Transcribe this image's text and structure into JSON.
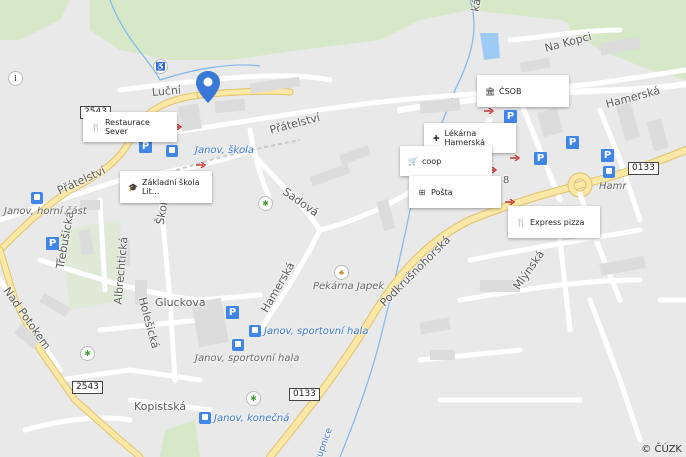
{
  "streets": {
    "na_kopci": "Na Kopci",
    "hamerska_ne": "Hamerská",
    "lucni": "Luční",
    "pratelstvi_1": "Přátelství",
    "pratelstvi_2": "Přátelství",
    "sadova": "Sadová",
    "podkrusnohorska": "Podkrušnohorská",
    "mlynska": "Mlýnská",
    "skolska": "Školská",
    "trebusicka": "Třebušická",
    "albrechticka": "Albrechtická",
    "holesicka": "Holešická",
    "gluckova": "Gluckova",
    "hamerska_mid": "Hamerská",
    "nad_potokem": "Nad Potokem",
    "kopistska": "Kopistská",
    "dupnice": "Dupnice",
    "kostelni_partial": "ká",
    "partial_8": "8"
  },
  "stops": {
    "janov_skola": "Janov, škola",
    "janov_horni_cast": "Janov, horní část",
    "janov_sportovni_hala_blue": "Janov, sportovní hala",
    "janov_sportovni_hala_grey": "Janov, sportovní hala",
    "janov_konecna": "Janov, konečná",
    "hamr": "Hamr"
  },
  "places": {
    "pekarna": "Pekárna Japek"
  },
  "popups": {
    "restaurace_sever": "Restaurace Sever",
    "zakladni_skola": "Základní škola Lit...",
    "csob": "ČSOB",
    "lekarna_hamerska": "Lékárna Hamerská",
    "coop": "coop",
    "posta": "Pošta",
    "express_pizza": "Express pizza"
  },
  "road_numbers": {
    "r2543_top": "2543",
    "r2543_bottom": "2543",
    "r0133_right": "0133",
    "r0133_bottom": "0133"
  },
  "parking_label": "P",
  "info_label": "i",
  "copyright": "© ČÚZK",
  "colors": {
    "background": "#e9e9e9",
    "forest": "#d6e8c8",
    "main_road_fill": "#fbe8a6",
    "main_road_edge": "#e3c26a",
    "minor_road": "#ffffff",
    "water": "#9ecbf5",
    "stream": "#7fb6ef",
    "pin": "#3a78d8",
    "transit_blue": "#3f86e8"
  }
}
